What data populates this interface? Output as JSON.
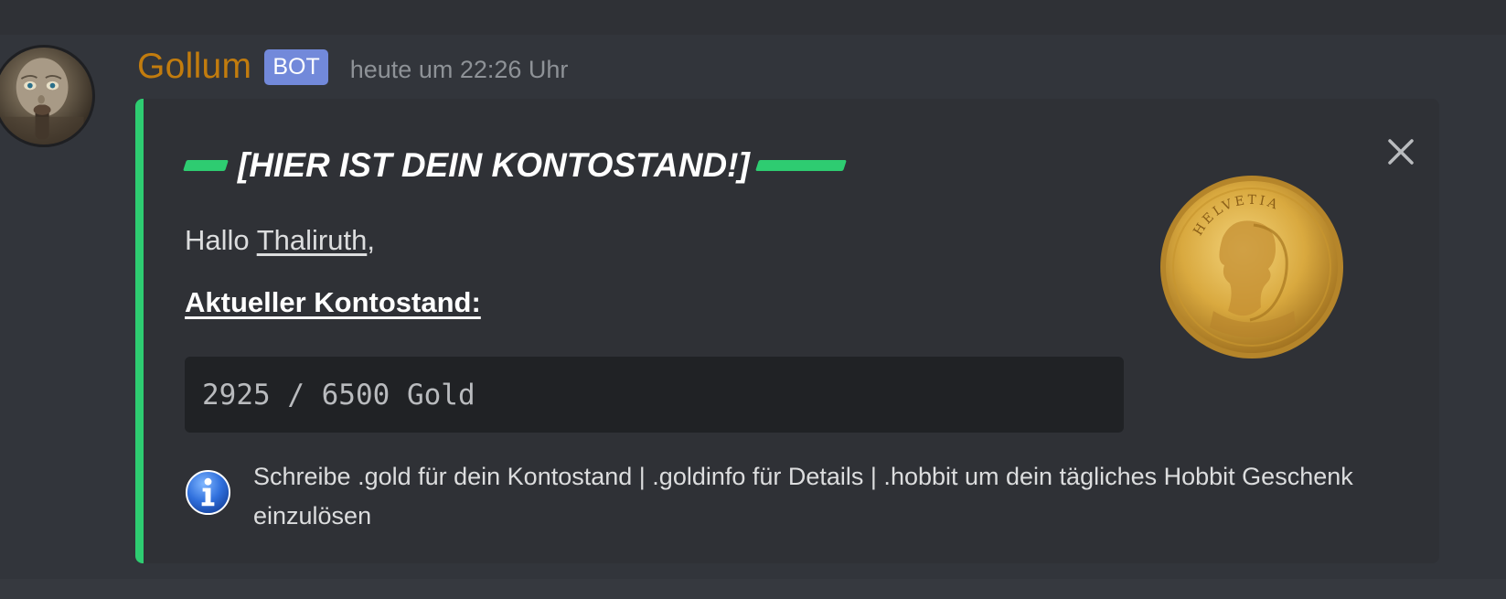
{
  "message": {
    "author": {
      "name": "Gollum",
      "bot_tag": "BOT",
      "avatar_icon": "gollum-avatar",
      "name_color": "#c27c0e"
    },
    "timestamp": "heute um 22:26 Uhr"
  },
  "embed": {
    "accent_color": "#2ecc71",
    "title": "[HIER IST DEIN KONTOSTAND!]",
    "greeting_prefix": "Hallo ",
    "mention": "Thaliruth",
    "greeting_suffix": ",",
    "balance_label": "Aktueller Kontostand:",
    "balance_value": "2925 / 6500 Gold",
    "footer_icon": "info-icon",
    "footer_text": "Schreibe .gold für dein Kontostand | .goldinfo für Details | .hobbit um dein tägliches Hobbit Geschenk einzulösen",
    "thumbnail_icon": "gold-coin",
    "coin_inscription": "HELVETIA"
  },
  "controls": {
    "close_icon": "close-icon"
  },
  "colors": {
    "background": "#36393f",
    "message_bg": "#32353b",
    "embed_bg": "#2f3136",
    "code_bg": "#202225",
    "bot_tag_bg": "#7289da"
  }
}
